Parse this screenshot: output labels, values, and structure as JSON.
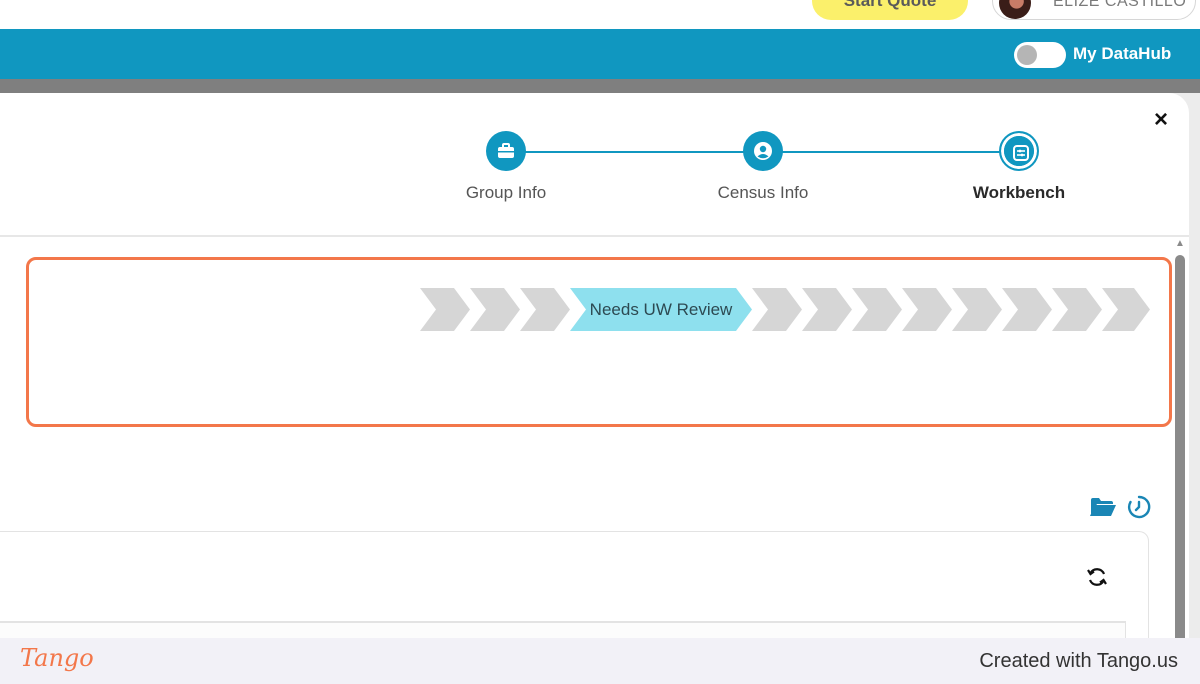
{
  "topbar": {
    "start_quote_label": "Start Quote",
    "user_name": "ELIZE CASTILLO"
  },
  "header": {
    "datahub_label": "My DataHub",
    "datahub_enabled": false
  },
  "modal": {
    "close_label": "×",
    "steps": [
      {
        "label": "Group Info",
        "icon": "briefcase-icon",
        "active": false
      },
      {
        "label": "Census Info",
        "icon": "user-circle-icon",
        "active": false
      },
      {
        "label": "Workbench",
        "icon": "sliders-icon",
        "active": true
      }
    ],
    "status_pipeline": {
      "stages_before": 3,
      "current_stage_label": "Needs UW Review",
      "stages_after": 8
    },
    "tools": {
      "folder_icon": "folder-open-icon",
      "history_icon": "history-clock-icon",
      "refresh_icon": "refresh-icon"
    }
  },
  "footer": {
    "logo_text": "Tango",
    "credit_text": "Created with Tango.us"
  },
  "colors": {
    "header_blue": "#1097c0",
    "highlight_orange": "#f3774a",
    "active_stage": "#8ee0ee",
    "inactive_stage": "#d6d6d6",
    "start_quote_yellow": "#fbf06b"
  }
}
